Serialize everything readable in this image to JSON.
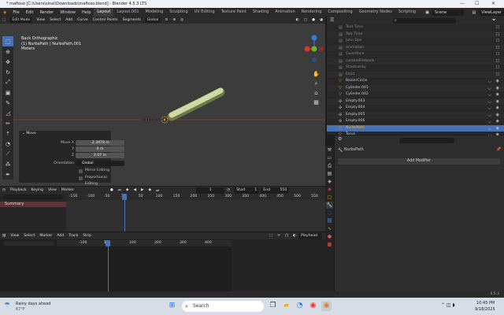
{
  "window": {
    "title": "* mafioso [C:\\Users\\sinai\\Downloads\\mafioso.blend] - Blender 4.5.3 LTS",
    "minimize": "—",
    "maximize": "☐",
    "close": "✕"
  },
  "menu": [
    "File",
    "Edit",
    "Render",
    "Window",
    "Help"
  ],
  "workspaces": [
    "Layout",
    "Layout.001",
    "Modeling",
    "Sculpting",
    "UV Editing",
    "Texture Paint",
    "Shading",
    "Animation",
    "Rendering",
    "Compositing",
    "Geometry Nodes",
    "Scripting"
  ],
  "scene": {
    "name": "Scene",
    "view_layer": "ViewLayer"
  },
  "viewport_header": {
    "mode": "Edit Mode",
    "menus": [
      "View",
      "Select",
      "Add",
      "Curve",
      "Control Points",
      "Segments"
    ],
    "orientation": "Global"
  },
  "viewport_overlay": {
    "view": "Back Orthographic",
    "object": "(1) NurbsPath | NurbsPath.001",
    "units": "Meters"
  },
  "move_panel": {
    "title": "Move",
    "move_x_label": "Move X",
    "move_x": "-2.3478 m",
    "y_label": "Y",
    "y": "0 m",
    "z_label": "Z",
    "z": "2.07 m",
    "orientation_label": "Orientation",
    "orientation": "Global",
    "mirror_editing": "Mirror Editing",
    "proportional_editing": "Proportional Editing"
  },
  "outliner": {
    "search_placeholder": "",
    "items": [
      {
        "name": "Text Time",
        "type": "grey"
      },
      {
        "name": "Two Time",
        "type": "grey"
      },
      {
        "name": "John Doe",
        "type": "grey"
      },
      {
        "name": "animation",
        "type": "grey"
      },
      {
        "name": "Guestface",
        "type": "grey"
      },
      {
        "name": "customFireback",
        "type": "grey"
      },
      {
        "name": "Shadowsky",
        "type": "grey"
      },
      {
        "name": "Eloid",
        "type": "grey"
      },
      {
        "name": "BezierCircle",
        "type": "obj"
      },
      {
        "name": "Cylinder.001",
        "type": "obj"
      },
      {
        "name": "Cylinder.002",
        "type": "obj"
      },
      {
        "name": "Empty.003",
        "type": "empty"
      },
      {
        "name": "Empty.004",
        "type": "empty"
      },
      {
        "name": "Empty.005",
        "type": "empty"
      },
      {
        "name": "Empty.006",
        "type": "empty"
      },
      {
        "name": "NurbsPath",
        "type": "selected"
      },
      {
        "name": "Torus",
        "type": "obj"
      }
    ]
  },
  "properties": {
    "object_name": "NurbsPath",
    "add_modifier": "Add Modifier"
  },
  "timeline": {
    "menus": [
      "Playback",
      "Keying",
      "View",
      "Marker"
    ],
    "current_frame": "1",
    "start_label": "Start",
    "start": "1",
    "end_label": "End",
    "end": "550",
    "summary": "Summary",
    "ruler": [
      "-150",
      "-100",
      "-50",
      "1",
      "50",
      "100",
      "150",
      "200",
      "250",
      "300",
      "350",
      "400",
      "450",
      "500",
      "550"
    ]
  },
  "sequencer": {
    "menus": [
      "View",
      "Select",
      "Marker",
      "Add",
      "Track",
      "Strip"
    ],
    "playhead": "Playhead",
    "ruler": [
      "-100",
      "1",
      "100",
      "200",
      "300",
      "400"
    ]
  },
  "status_bar": {
    "version": "4.5.3"
  },
  "taskbar": {
    "weather": "Rainy days ahead",
    "temperature": "67°F",
    "search": "Search",
    "time": "10:45 PM",
    "date": "9/18/2025"
  },
  "colors": {
    "accent": "#4772b3",
    "curve": "#cfd9a6",
    "selected_text": "#ffaf29"
  }
}
